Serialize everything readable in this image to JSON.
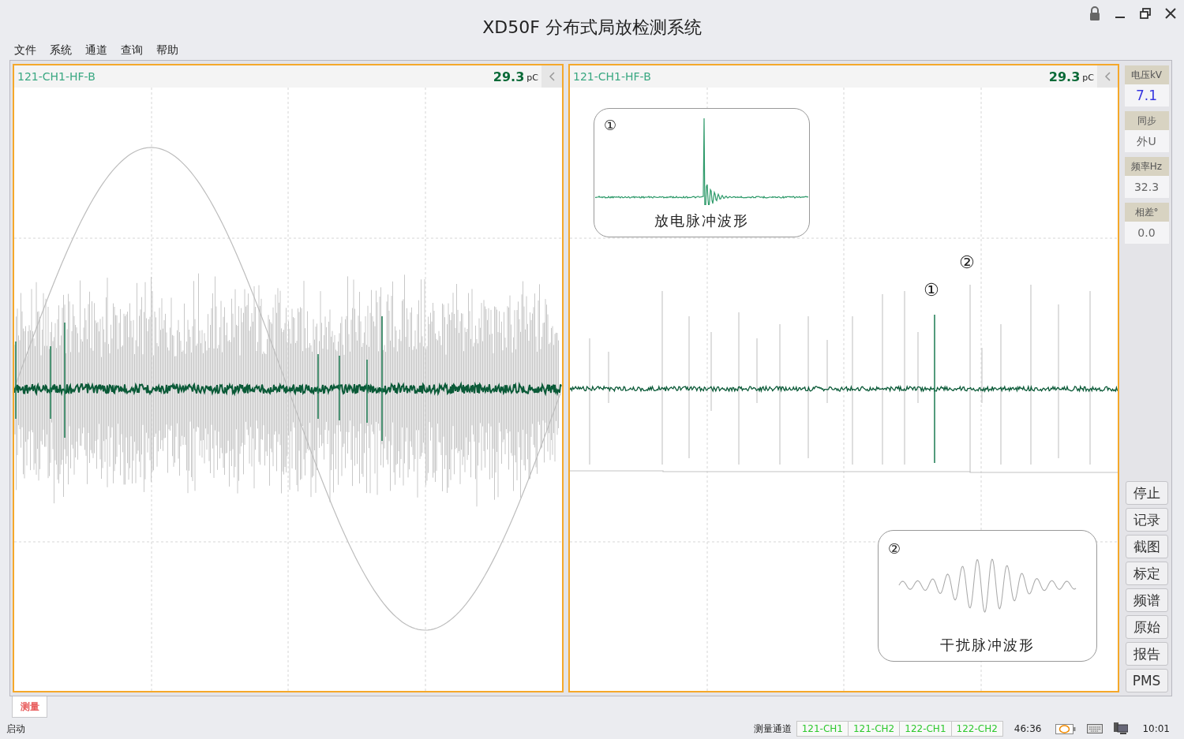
{
  "window": {
    "title": "XD50F  分布式局放检测系统"
  },
  "menu": [
    "文件",
    "系统",
    "通道",
    "查询",
    "帮助"
  ],
  "panels": [
    {
      "kind": "phase",
      "channel": "121-CH1-HF-B",
      "value": "29.3",
      "unit": "pC"
    },
    {
      "kind": "pulse",
      "channel": "121-CH1-HF-B",
      "value": "29.3",
      "unit": "pC",
      "insets": [
        {
          "kind": "discharge",
          "number": "①",
          "caption": "放电脉冲波形"
        },
        {
          "kind": "interference",
          "number": "②",
          "caption": "干扰脉冲波形"
        }
      ],
      "markers": [
        "①",
        "②"
      ]
    }
  ],
  "readings": [
    {
      "label": "电压kV",
      "value": "7.1",
      "emphasized": true
    },
    {
      "label": "同步",
      "value": "外U",
      "emphasized": false
    },
    {
      "label": "频率Hz",
      "value": "32.3",
      "emphasized": false
    },
    {
      "label": "相差°",
      "value": "0.0",
      "emphasized": false
    }
  ],
  "buttons": [
    "停止",
    "记录",
    "截图",
    "标定",
    "频谱",
    "原始",
    "报告",
    "PMS"
  ],
  "tabs": [
    {
      "label": "测量",
      "selected": true
    }
  ],
  "status_bar": {
    "state": "启动",
    "channels_label": "测量通道",
    "channels": [
      "121-CH1",
      "121-CH2",
      "122-CH1",
      "122-CH2"
    ],
    "elapsed": "46:36",
    "clock": "10:01"
  }
}
